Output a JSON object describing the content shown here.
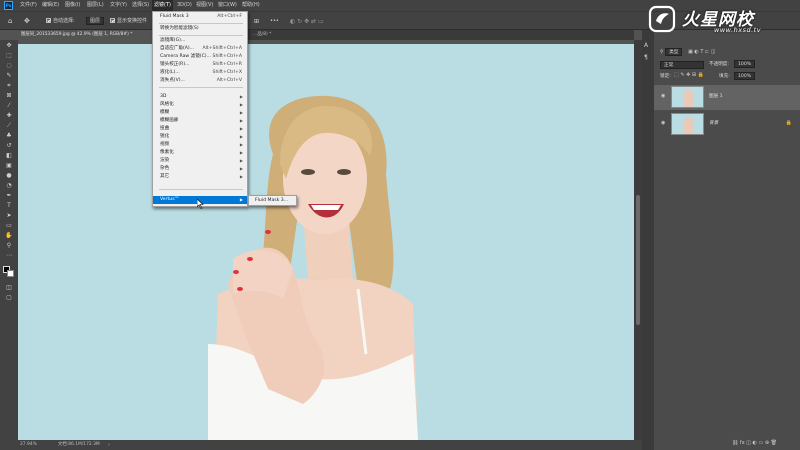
{
  "menubar": {
    "app_logo": "Ps",
    "items": [
      "文件(F)",
      "编辑(E)",
      "图像(I)",
      "图层(L)",
      "文字(Y)",
      "选择(S)",
      "滤镜(T)",
      "3D(D)",
      "视图(V)",
      "窗口(W)",
      "帮助(H)"
    ]
  },
  "options_bar": {
    "auto_select_label": "自动选择:",
    "auto_select_value": "图层",
    "show_transform_label": "显示变换控件",
    "more": "•••"
  },
  "tabs": [
    {
      "label": "图层同_201533659.jpg @ 42.9% (图层 1, RGB/8#) *",
      "active": true
    },
    {
      "label": "…品/8) *",
      "active": false
    }
  ],
  "filter_menu": {
    "items": [
      {
        "label": "Fluid Mask 3",
        "shortcut": "Alt+Ctrl+F"
      },
      {
        "label": "转换为智能滤镜(S)"
      },
      {
        "label": "滤镜库(G)..."
      },
      {
        "label": "自适应广角(A)...",
        "shortcut": "Alt+Shift+Ctrl+A"
      },
      {
        "label": "Camera Raw 滤镜(C)...",
        "shortcut": "Shift+Ctrl+A"
      },
      {
        "label": "镜头校正(R)...",
        "shortcut": "Shift+Ctrl+R"
      },
      {
        "label": "液化(L)...",
        "shortcut": "Shift+Ctrl+X"
      },
      {
        "label": "消失点(V)...",
        "shortcut": "Alt+Ctrl+V"
      },
      {
        "label": "3D"
      },
      {
        "label": "风格化"
      },
      {
        "label": "模糊"
      },
      {
        "label": "模糊画廊"
      },
      {
        "label": "扭曲"
      },
      {
        "label": "锐化"
      },
      {
        "label": "视频"
      },
      {
        "label": "像素化"
      },
      {
        "label": "渲染"
      },
      {
        "label": "杂色"
      },
      {
        "label": "其它"
      },
      {
        "label": "Vertus™"
      }
    ],
    "submenu_item": "Fluid Mask 3..."
  },
  "status_bar": {
    "zoom": "27.94%",
    "doc": "文档:86.1M/172.3M"
  },
  "layers_panel": {
    "search_kind": "类型",
    "blend_mode": "正常",
    "opacity_label": "不透明度:",
    "opacity_value": "100%",
    "lock_label": "锁定:",
    "fill_label": "填充:",
    "fill_value": "100%",
    "layers": [
      {
        "name": "图层 1",
        "selected": true
      },
      {
        "name": "背景",
        "selected": false
      }
    ]
  },
  "watermark": {
    "title": "火星网校",
    "url": "www.hxsd.tv"
  },
  "colors": {
    "canvas_bg": "#b9dde3",
    "menu_highlight": "#0078d7",
    "ui_dark": "#424242"
  }
}
